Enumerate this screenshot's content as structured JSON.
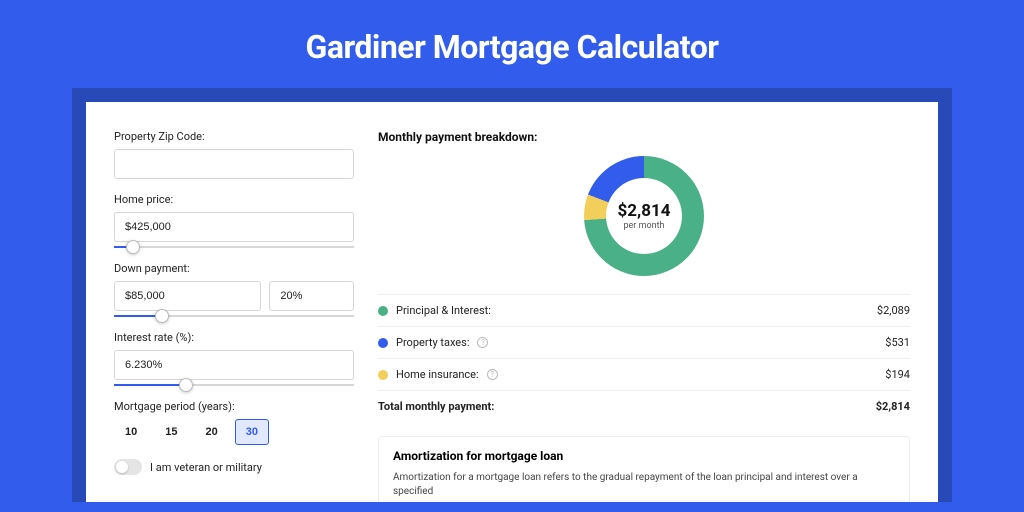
{
  "page": {
    "title": "Gardiner Mortgage Calculator"
  },
  "form": {
    "zip": {
      "label": "Property Zip Code:",
      "value": ""
    },
    "price": {
      "label": "Home price:",
      "value": "$425,000",
      "slider_pct": 8
    },
    "down": {
      "label": "Down payment:",
      "value": "$85,000",
      "pct": "20%",
      "slider_pct": 20
    },
    "rate": {
      "label": "Interest rate (%):",
      "value": "6.230%",
      "slider_pct": 30
    },
    "period": {
      "label": "Mortgage period (years):",
      "options": [
        "10",
        "15",
        "20",
        "30"
      ],
      "selected": "30"
    },
    "veteran": {
      "label": "I am veteran or military",
      "on": false
    }
  },
  "breakdown": {
    "title": "Monthly payment breakdown:",
    "total_value": "$2,814",
    "total_sub": "per month",
    "items": [
      {
        "label": "Principal & Interest:",
        "value": "$2,089",
        "color": "green",
        "info": false
      },
      {
        "label": "Property taxes:",
        "value": "$531",
        "color": "blue",
        "info": true
      },
      {
        "label": "Home insurance:",
        "value": "$194",
        "color": "yellow",
        "info": true
      }
    ],
    "total_row": {
      "label": "Total monthly payment:",
      "value": "$2,814"
    }
  },
  "amortization": {
    "title": "Amortization for mortgage loan",
    "text": "Amortization for a mortgage loan refers to the gradual repayment of the loan principal and interest over a specified"
  },
  "chart_data": {
    "type": "pie",
    "title": "Monthly payment breakdown",
    "series": [
      {
        "name": "Principal & Interest",
        "value": 2089,
        "color": "#4ab087"
      },
      {
        "name": "Property taxes",
        "value": 531,
        "color": "#325CEB"
      },
      {
        "name": "Home insurance",
        "value": 194,
        "color": "#f2cf5b"
      }
    ],
    "total": 2814,
    "center_label": "$2,814",
    "center_sub": "per month"
  }
}
